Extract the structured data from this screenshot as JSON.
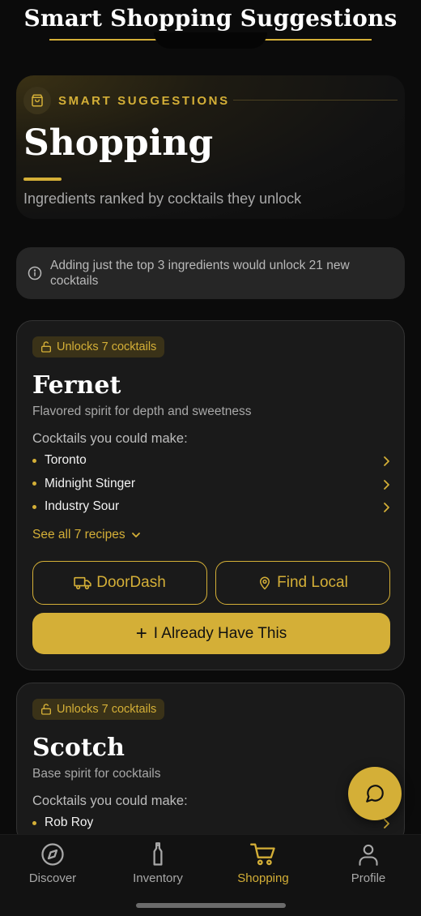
{
  "header": {
    "title": "Smart Shopping Suggestions"
  },
  "hero": {
    "eyebrow": "SMART SUGGESTIONS",
    "title": "Shopping",
    "subtitle": "Ingredients ranked by cocktails they unlock",
    "icon": "shopping-bag-icon"
  },
  "info_banner": {
    "text": "Adding just the top 3 ingredients would unlock 21 new cocktails",
    "icon": "info-icon"
  },
  "cards": [
    {
      "badge": "Unlocks 7 cocktails",
      "name": "Fernet",
      "description": "Flavored spirit for depth and sweetness",
      "could_label": "Cocktails you could make:",
      "recipes": [
        "Toronto",
        "Midnight Stinger",
        "Industry Sour"
      ],
      "see_all": "See all 7 recipes",
      "doordash_label": "DoorDash",
      "find_local_label": "Find Local",
      "have_label": "I Already Have This"
    },
    {
      "badge": "Unlocks 7 cocktails",
      "name": "Scotch",
      "description": "Base spirit for cocktails",
      "could_label": "Cocktails you could make:",
      "recipes": [
        "Rob Roy"
      ]
    }
  ],
  "fab": {
    "icon": "chat-bubble-icon"
  },
  "tabbar": {
    "items": [
      {
        "label": "Discover",
        "icon": "compass-icon"
      },
      {
        "label": "Inventory",
        "icon": "bottle-icon"
      },
      {
        "label": "Shopping",
        "icon": "cart-icon",
        "active": true
      },
      {
        "label": "Profile",
        "icon": "user-icon"
      }
    ]
  },
  "colors": {
    "accent": "#d4af37",
    "background": "#0b0b0b",
    "card": "#1a1a1a"
  }
}
